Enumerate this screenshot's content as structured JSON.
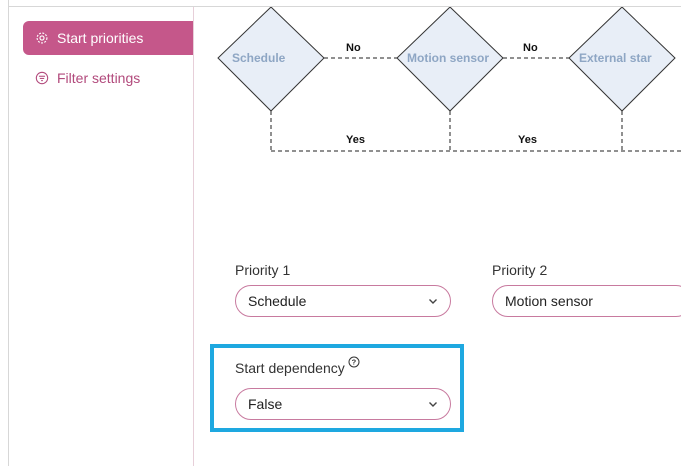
{
  "sidebar": {
    "items": [
      {
        "label": "Start priorities",
        "icon": "gear-icon",
        "active": true
      },
      {
        "label": "Filter settings",
        "icon": "filter-icon",
        "active": false
      }
    ]
  },
  "flow": {
    "nodes": [
      "Schedule",
      "Motion sensor",
      "External star"
    ],
    "no_label": "No",
    "yes_label": "Yes"
  },
  "priority1": {
    "label": "Priority 1",
    "value": "Schedule"
  },
  "priority2": {
    "label": "Priority 2",
    "value": "Motion sensor"
  },
  "start_dependency": {
    "label": "Start dependency",
    "value": "False",
    "help_icon": "question-circle-icon"
  },
  "colors": {
    "accent": "#c5578a",
    "highlight": "#1ea8e0",
    "diamond_fill": "#e8eef7"
  }
}
